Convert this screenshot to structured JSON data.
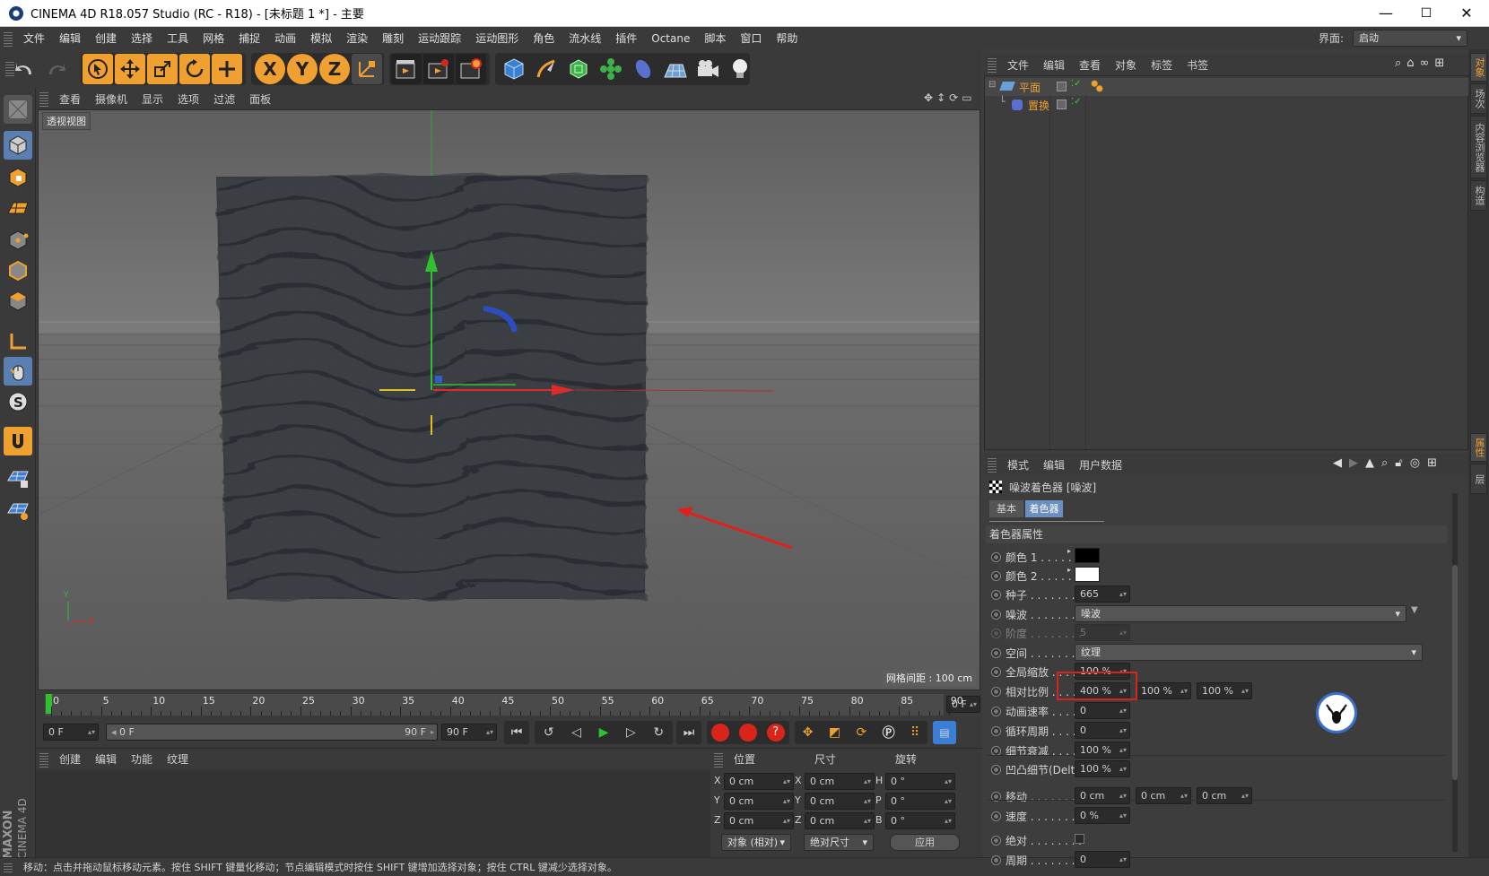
{
  "window": {
    "title": "CINEMA 4D R18.057 Studio (RC - R18) - [未标题 1 *] - 主要",
    "min": "—",
    "max": "☐",
    "close": "✕"
  },
  "menubar": {
    "items": [
      "文件",
      "编辑",
      "创建",
      "选择",
      "工具",
      "网格",
      "捕捉",
      "动画",
      "模拟",
      "渲染",
      "雕刻",
      "运动跟踪",
      "运动图形",
      "角色",
      "流水线",
      "插件",
      "Octane",
      "脚本",
      "窗口",
      "帮助"
    ],
    "layout_label": "界面:",
    "layout_value": "启动"
  },
  "toolbar": {
    "axis_x": "X",
    "axis_y": "Y",
    "axis_z": "Z"
  },
  "viewport": {
    "menu": [
      "查看",
      "摄像机",
      "显示",
      "选项",
      "过滤",
      "面板"
    ],
    "label": "透视视图",
    "grid_info": "网格间距 : 100 cm",
    "axis_y": "Y",
    "axis_x": "X"
  },
  "timeline": {
    "ticks": [
      "0",
      "5",
      "10",
      "15",
      "20",
      "25",
      "30",
      "35",
      "40",
      "45",
      "50",
      "55",
      "60",
      "65",
      "70",
      "75",
      "80",
      "85",
      "90"
    ],
    "current": "0 F"
  },
  "transport": {
    "start": "0 F",
    "range_start": "0 F",
    "range_end": "90 F",
    "end": "90 F"
  },
  "material_manager": {
    "menu": [
      "创建",
      "编辑",
      "功能",
      "纹理"
    ]
  },
  "coordinates": {
    "headers": [
      "位置",
      "尺寸",
      "旋转"
    ],
    "rows": [
      {
        "l1": "X",
        "v1": "0 cm",
        "l2": "X",
        "v2": "0 cm",
        "l3": "H",
        "v3": "0 °"
      },
      {
        "l1": "Y",
        "v1": "0 cm",
        "l2": "Y",
        "v2": "0 cm",
        "l3": "P",
        "v3": "0 °"
      },
      {
        "l1": "Z",
        "v1": "0 cm",
        "l2": "Z",
        "v2": "0 cm",
        "l3": "B",
        "v3": "0 °"
      }
    ],
    "mode1": "对象 (相对)",
    "mode2": "绝对尺寸",
    "apply": "应用"
  },
  "object_manager": {
    "menu": [
      "文件",
      "编辑",
      "查看",
      "对象",
      "标签",
      "书签"
    ],
    "objects": [
      {
        "name": "平面"
      },
      {
        "name": "置换"
      }
    ]
  },
  "attribute_manager": {
    "menu": [
      "模式",
      "编辑",
      "用户数据"
    ],
    "title": "噪波着色器 [噪波]",
    "tabs": [
      "基本",
      "着色器"
    ],
    "section": "着色器属性",
    "props": [
      {
        "label": "颜色 1 . . . . . .",
        "type": "color",
        "color": "#000000"
      },
      {
        "label": "颜色 2 . . . . . .",
        "type": "color",
        "color": "#ffffff"
      },
      {
        "label": "种子 . . . . . . . . .",
        "type": "field",
        "value": "665"
      },
      {
        "label": "噪波 . . . . . . . . .",
        "type": "dropdown",
        "value": "噪波"
      },
      {
        "label": "阶度 . . . . . . . . .",
        "type": "field",
        "value": "5",
        "disabled": true
      },
      {
        "label": "空间 . . . . . . . . .",
        "type": "dropdown",
        "value": "纹理"
      },
      {
        "label": "全局缩放 . . . . . .",
        "type": "field",
        "value": "100 %"
      },
      {
        "label": "相对比例 . . . . . .",
        "type": "triple",
        "value": "400 %",
        "value2": "100 %",
        "value3": "100 %"
      },
      {
        "label": "动画速率 . . . . . .",
        "type": "field",
        "value": "0"
      },
      {
        "label": "循环周期 . . . . . .",
        "type": "field",
        "value": "0"
      },
      {
        "label": "细节衰减 . . . . . .",
        "type": "field",
        "value": "100 %"
      },
      {
        "label": "凹凸细节(Delta)",
        "type": "field",
        "value": "100 %"
      },
      {
        "label": "移动 . . . . . . . . .",
        "type": "triple",
        "value": "0 cm",
        "value2": "0 cm",
        "value3": "0 cm"
      },
      {
        "label": "速度 . . . . . . . . .",
        "type": "field",
        "value": "0 %"
      },
      {
        "label": "绝对 . . . . . . . . .",
        "type": "check"
      },
      {
        "label": "周期 . . . . . . . . .",
        "type": "field",
        "value": "0"
      }
    ]
  },
  "right_tabs": [
    "对象",
    "场次",
    "内容浏览器",
    "构造",
    "属性",
    "层"
  ],
  "status": "移动：点击并拖动鼠标移动元素。按住 SHIFT 键量化移动；节点编辑模式时按住 SHIFT 键增加选择对象；按住 CTRL 键减少选择对象。",
  "brand": {
    "maxon": "MAXON",
    "c4d": "CINEMA 4D"
  },
  "accent_colors": {
    "orange": "#f0a030",
    "blue": "#3a7fd5",
    "highlight_red": "#d9241c"
  }
}
